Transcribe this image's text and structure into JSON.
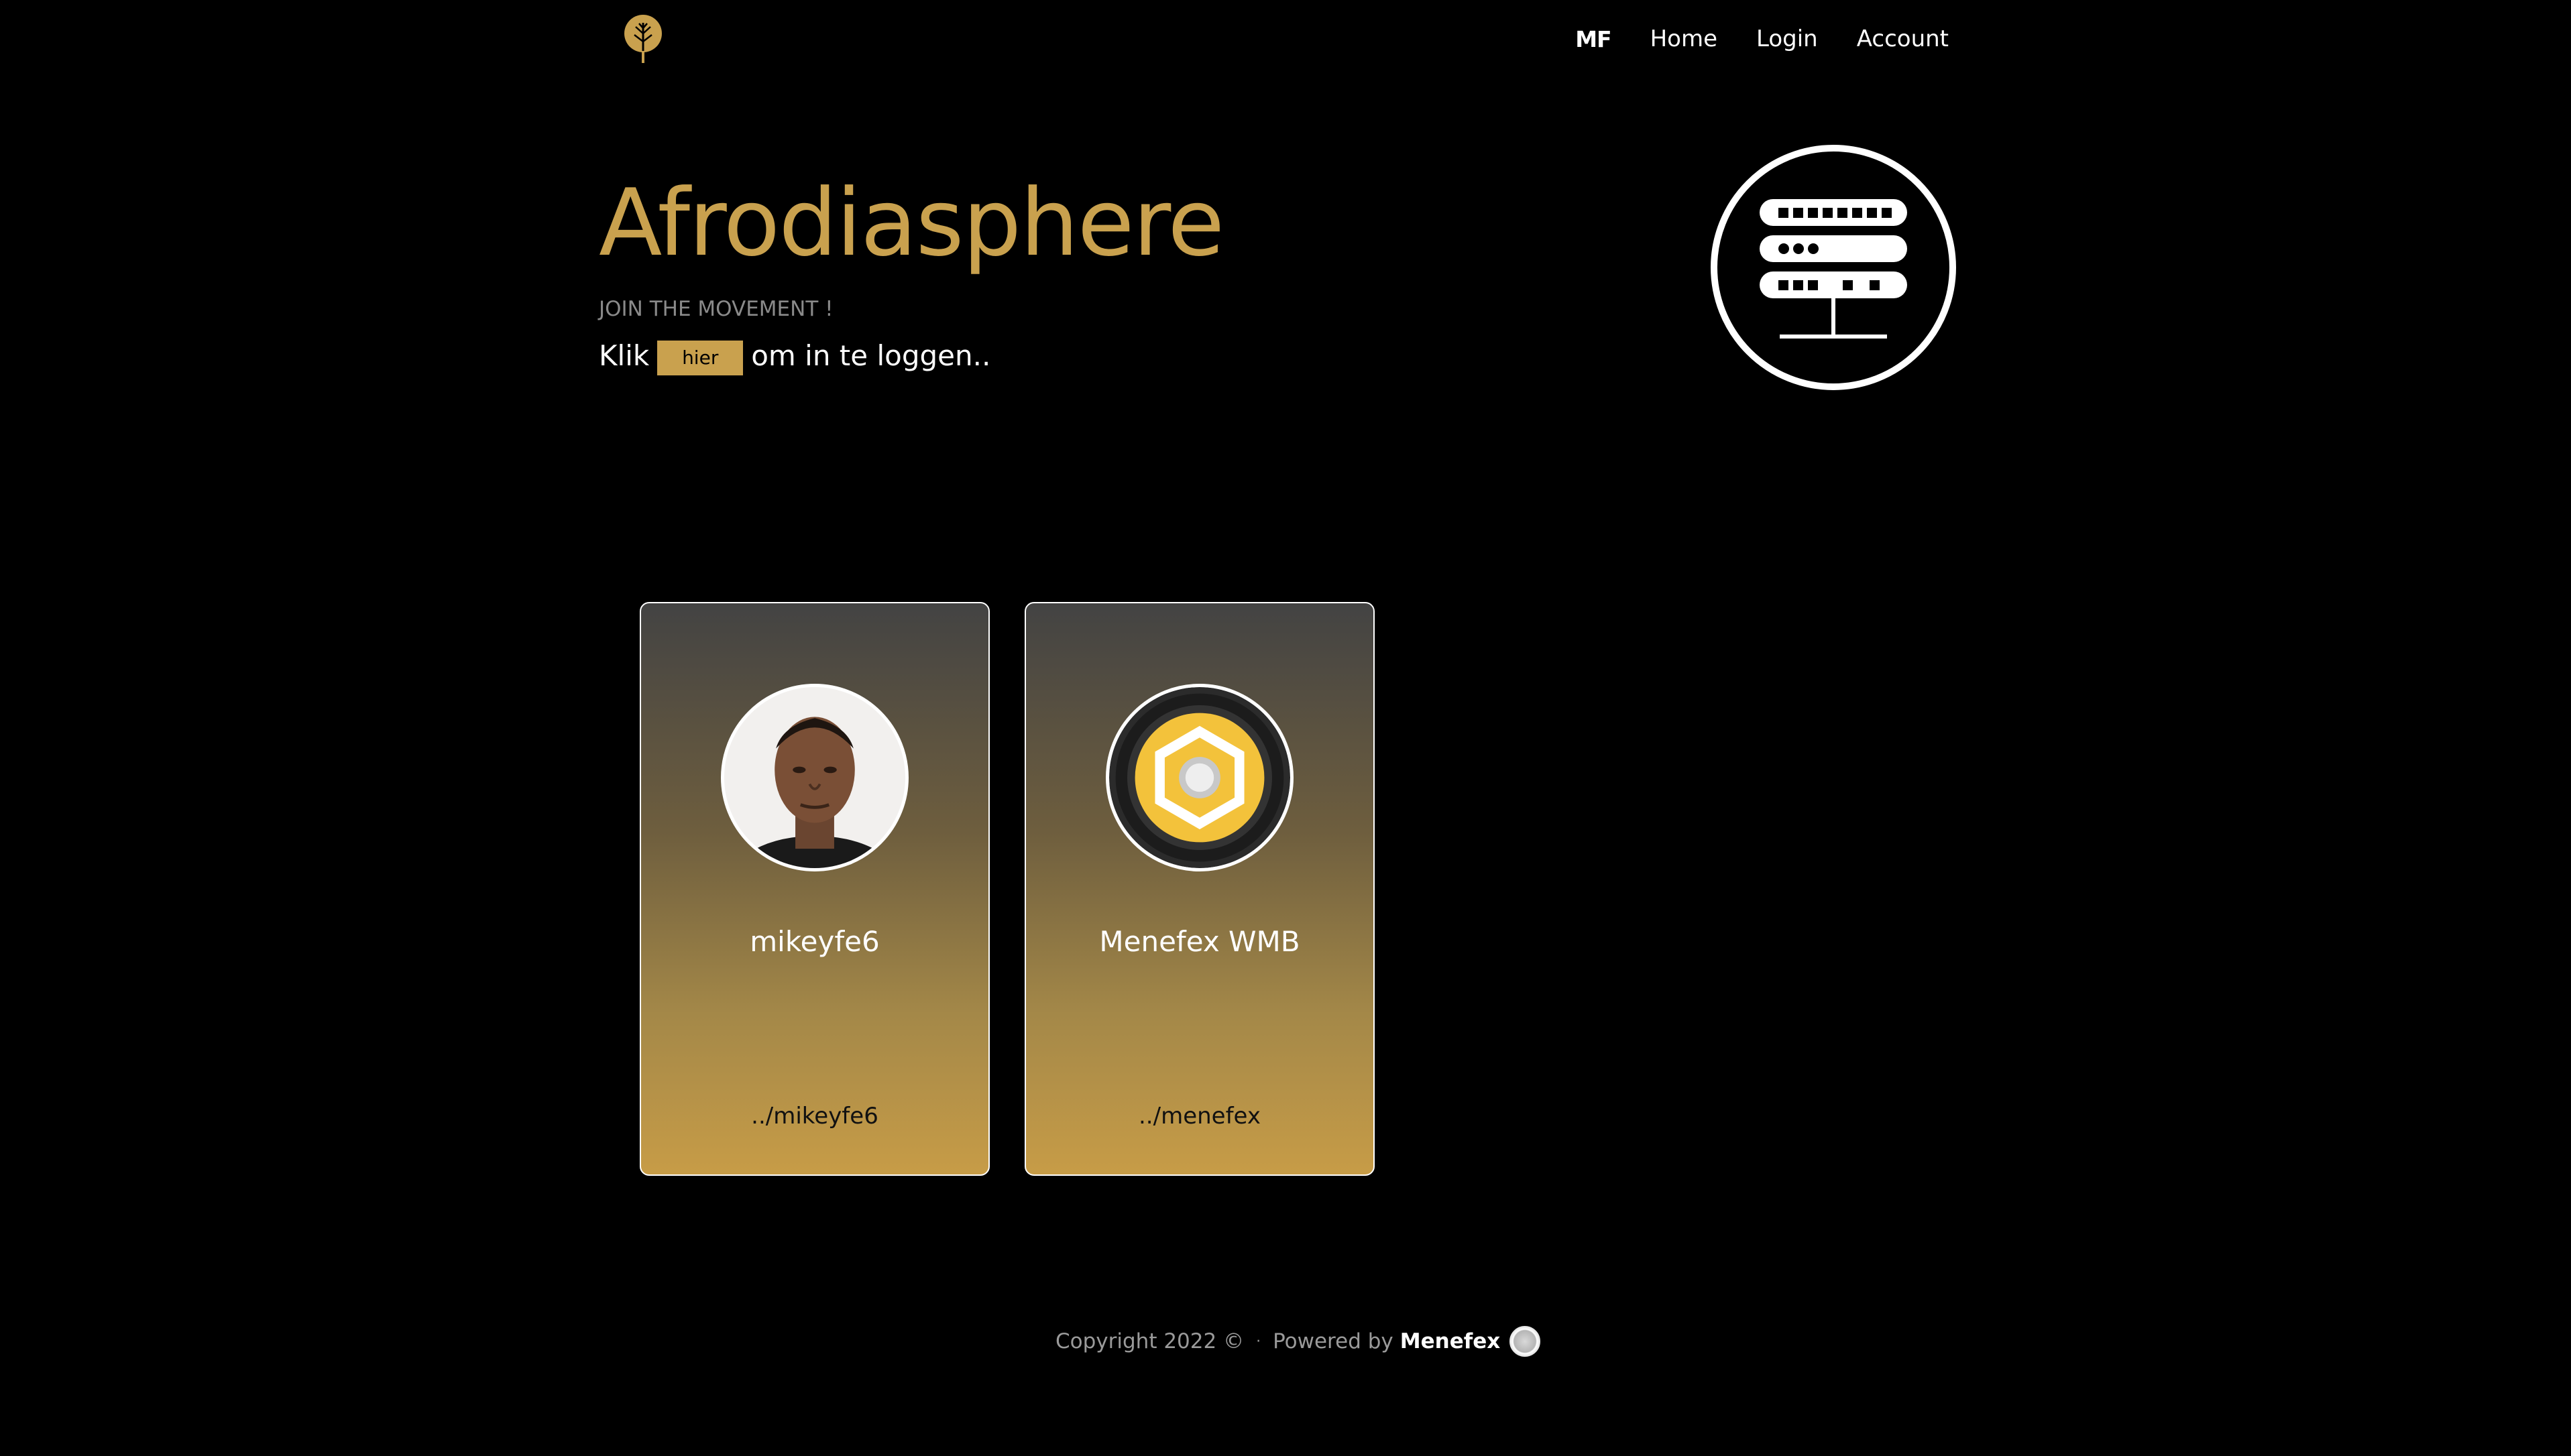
{
  "nav": {
    "brand": "MF",
    "links": [
      "Home",
      "Login",
      "Account"
    ]
  },
  "hero": {
    "title": "Afrodiasphere",
    "subtitle": "JOIN THE MOVEMENT !",
    "login_prefix": "Klik",
    "login_button": "hier",
    "login_suffix": "om in te loggen.."
  },
  "cards": [
    {
      "name": "mikeyfe6",
      "link": "../mikeyfe6",
      "avatar": "portrait-photo"
    },
    {
      "name": "Menefex WMB",
      "link": "../menefex",
      "avatar": "hexagon-logo-icon"
    }
  ],
  "footer": {
    "copyright": "Copyright 2022 ©",
    "separator": "·",
    "powered_by": "Powered by",
    "brand": "Menefex"
  },
  "colors": {
    "accent": "#c9a14e",
    "background": "#000000",
    "text": "#ffffff"
  }
}
